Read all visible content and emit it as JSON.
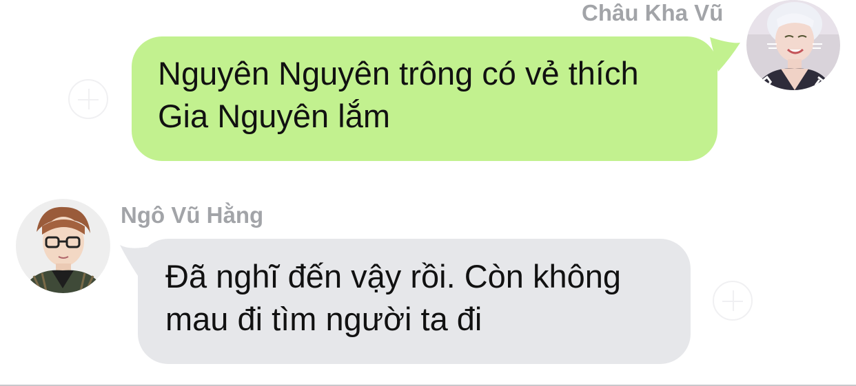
{
  "messages": [
    {
      "sender": "Châu Kha Vũ",
      "direction": "outgoing",
      "text": "Nguyên Nguyên trông có vẻ thích\nGia Nguyên lắm",
      "bubble_color": "#c2f18f",
      "avatar_icon": "avatar-photo-icon"
    },
    {
      "sender": "Ngô Vũ Hằng",
      "direction": "incoming",
      "text": "Đã nghĩ đến vậy rồi. Còn không\nmau đi tìm người ta đi",
      "bubble_color": "#e6e7ea",
      "avatar_icon": "avatar-photo-icon"
    }
  ],
  "icons": {
    "left_action": "add-circle-icon",
    "right_action": "add-circle-icon"
  },
  "colors": {
    "sender_name": "#a2a4a8",
    "text": "#111111",
    "background": "#ffffff"
  }
}
